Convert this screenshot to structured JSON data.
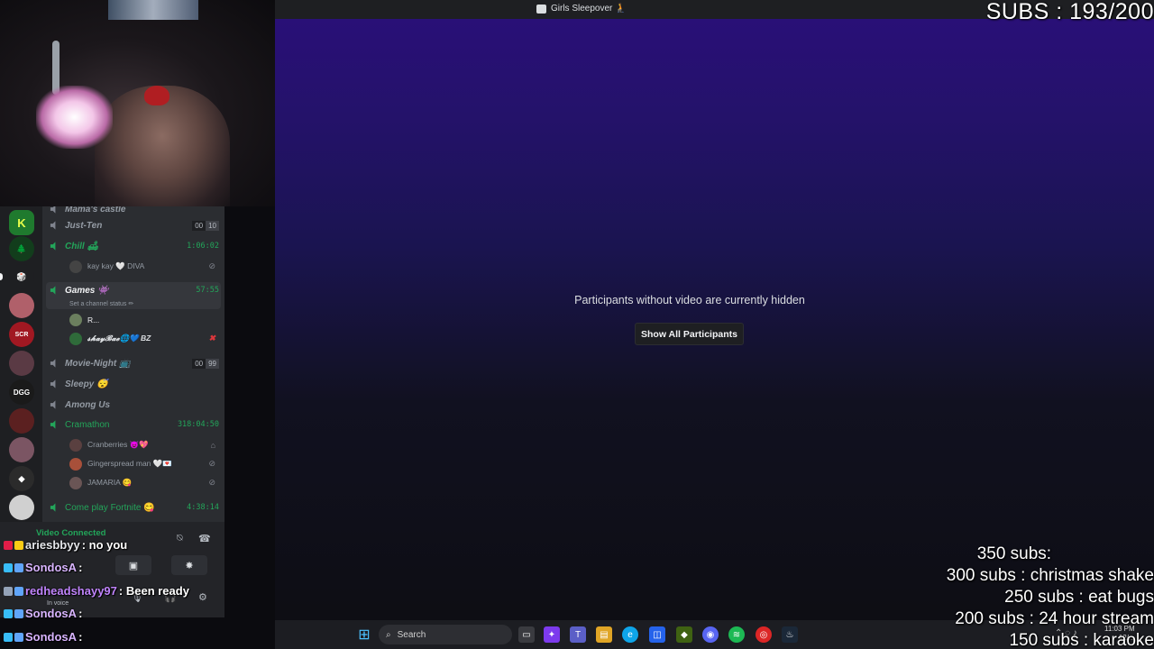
{
  "call": {
    "title": "Girls Sleepover 🧎",
    "hidden_message": "Participants without video are currently hidden",
    "show_button": "Show All Participants"
  },
  "overlay": {
    "subs_counter": "SUBS : 193/200",
    "goals_header": "350 subs:",
    "goals": [
      "300 subs : christmas shake",
      "250 subs : eat bugs",
      "200 subs : 24 hour stream",
      "150 subs : karaoke"
    ]
  },
  "channels": {
    "partial_top": "Mama's castle",
    "items": [
      {
        "name": "Just-Ten",
        "count_a": "00",
        "count_b": "10"
      },
      {
        "name": "Chill 🛋",
        "time": "1:06:02"
      },
      {
        "name": "Games 👾",
        "time": "57:55",
        "status": "Set a channel status ✏"
      },
      {
        "name": "Movie-Night 📺",
        "count_a": "00",
        "count_b": "99"
      },
      {
        "name": "Sleepy 😴"
      },
      {
        "name": "Among Us"
      },
      {
        "name": "Cramathon",
        "time": "318:04:50"
      },
      {
        "name": "Come play Fortnite 😋",
        "time": "4:38:14"
      }
    ],
    "users": {
      "chill": [
        "kay kay 🤍 DIVA"
      ],
      "games": [
        "R...",
        "𝓼𝓱𝓪𝔂𝓑𝓪𝓮🌐💙 BZ"
      ],
      "cramathon": [
        "Cranberries 😈💖",
        "Gingerspread man 🤍💌",
        "JAMARIA 😋"
      ]
    }
  },
  "voice": {
    "status": "Video Connected",
    "user_status": "In voice"
  },
  "chat": [
    {
      "name": "ariesbbyy",
      "text": ": no you"
    },
    {
      "name": "SondosA",
      "text": ":"
    },
    {
      "name": "redheadshayy97",
      "text": ": Been ready"
    },
    {
      "name": "SondosA",
      "text": ":"
    },
    {
      "name": "SondosA",
      "text": ":"
    }
  ],
  "taskbar": {
    "search_label": "Search",
    "time": "11:03 PM",
    "date": "12/..."
  },
  "colors": {
    "discord_green": "#23a55a",
    "stage_top": "#2a0f7a",
    "sidebar": "#2b2d31"
  }
}
